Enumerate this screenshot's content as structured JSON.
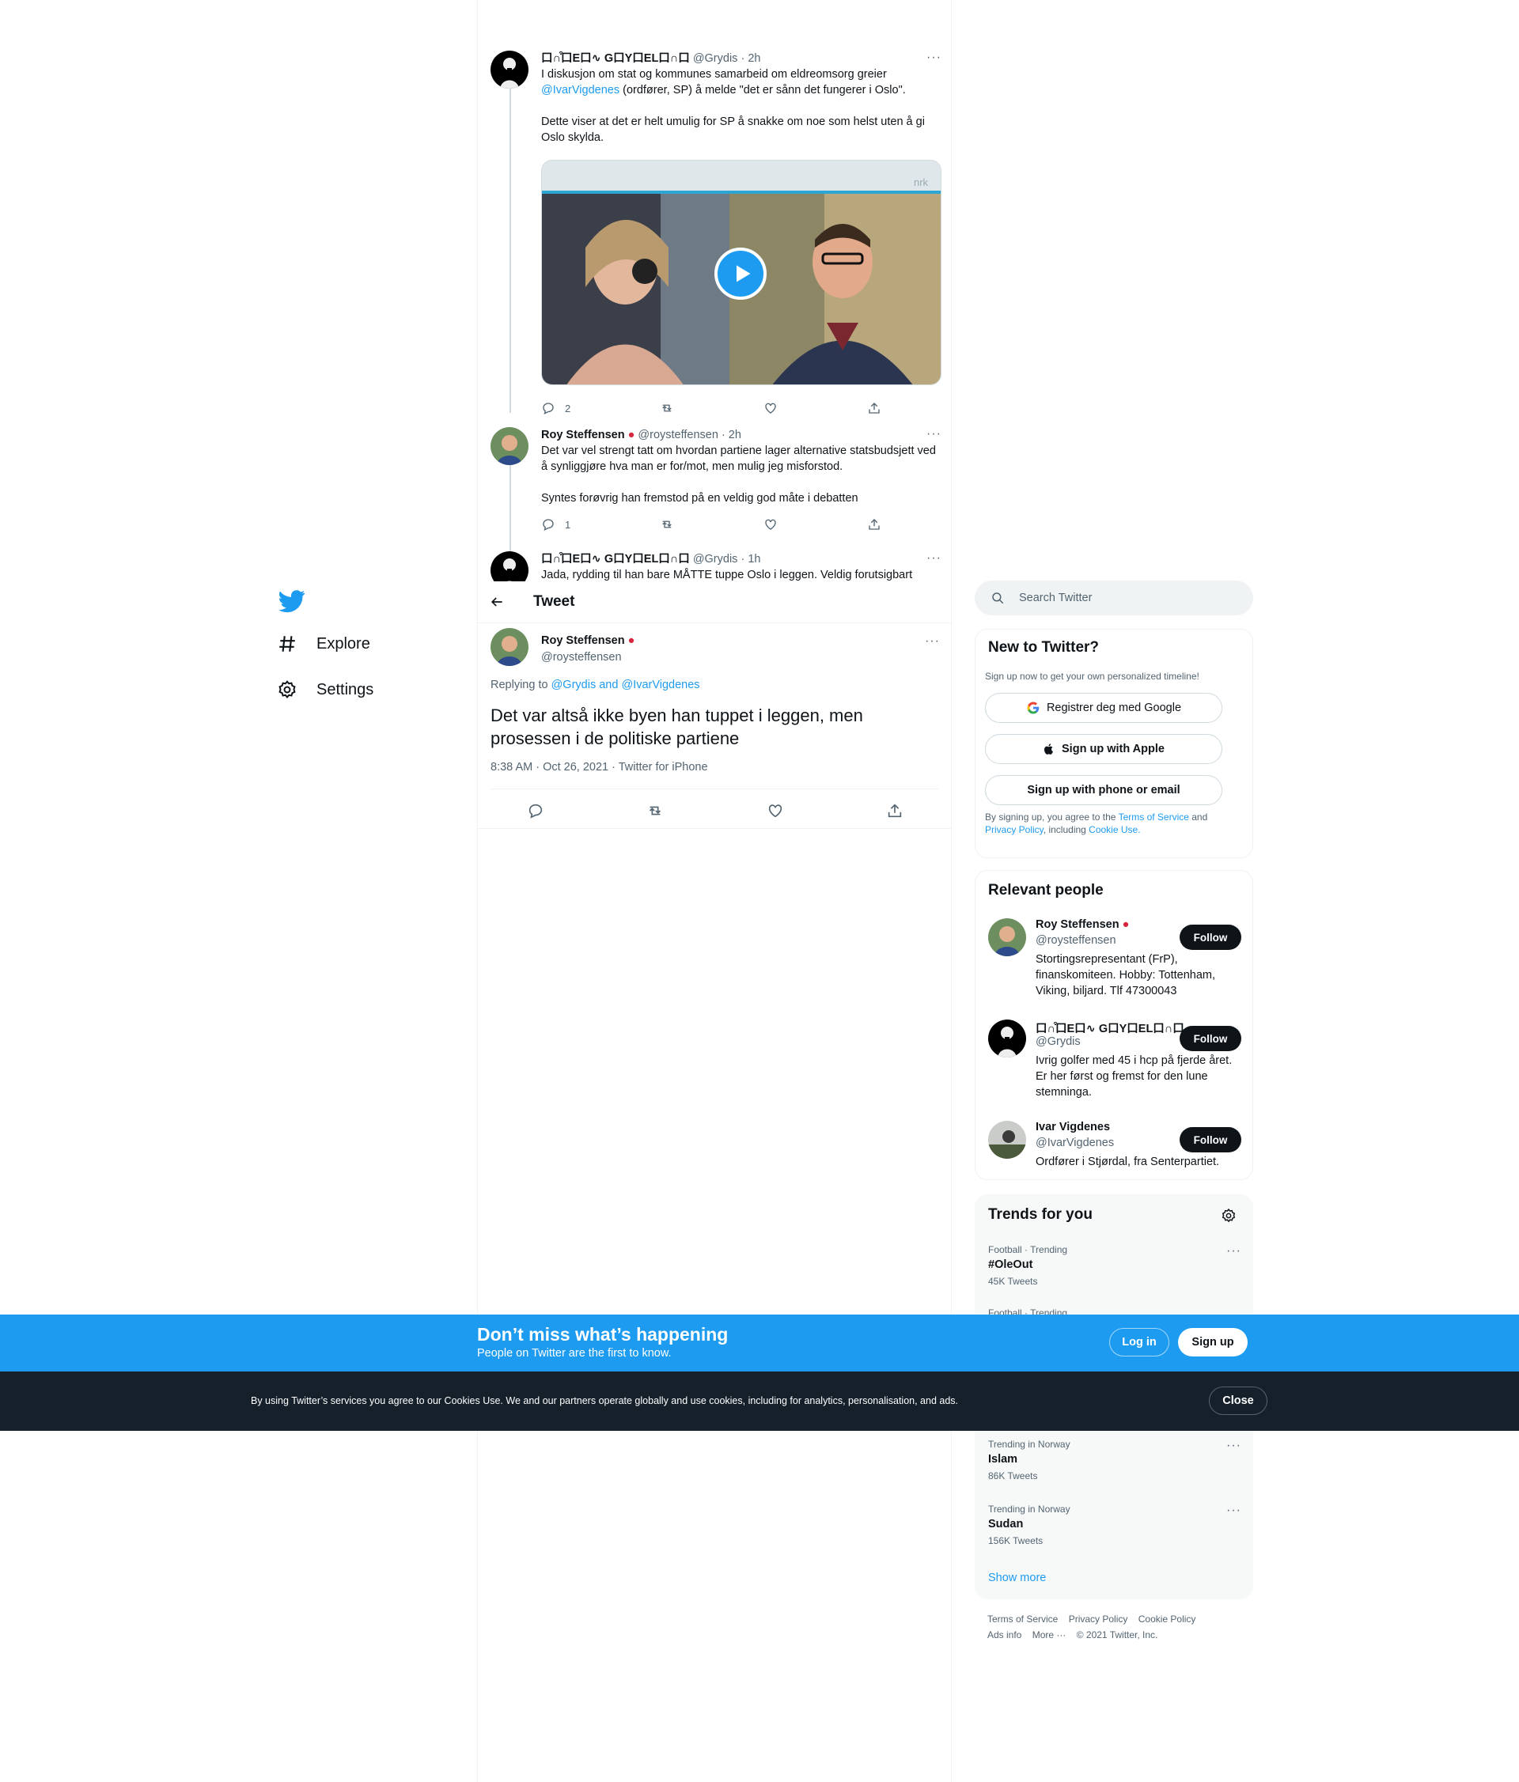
{
  "nav": {
    "items": [
      {
        "label": "Explore",
        "icon": "hashtag-icon"
      },
      {
        "label": "Settings",
        "icon": "gear-icon"
      }
    ]
  },
  "thread": [
    {
      "name": "⼝∩͒⼝E⼝∿ G⼝Y⼝EL⼝∩⼝",
      "handle": "@Grydis",
      "time": "· 2h",
      "text_pre": "I diskusjon om stat og kommunes samarbeid om eldreomsorg greier",
      "mention": "@IvarVigdenes",
      "text_post": " (ordfører, SP) å melde \"det er sånn det fungerer i Oslo\".\n\nDette viser at det er helt umulig for SP å snakke om noe som helst uten å gi Oslo skylda.",
      "replies": "2",
      "media_badge": "nrk"
    },
    {
      "name": "Roy Steffensen",
      "handle": "@roysteffensen",
      "time": "· 2h",
      "text": "Det var vel strengt tatt om hvordan partiene lager alternative statsbudsjett ved å synliggjøre hva man er for/mot, men mulig jeg misforstod.\n\nSyntes forøvrig han fremstod på en veldig god måte i debatten",
      "replies": "1"
    },
    {
      "name": "⼝∩͒⼝E⼝∿ G⼝Y⼝EL⼝∩⼝",
      "handle": "@Grydis",
      "time": "· 1h",
      "text": "Jada, rydding til han bare MÅTTE tuppe Oslo i leggen. Veldig forutsigbart"
    }
  ],
  "header": {
    "title": "Tweet"
  },
  "main_tweet": {
    "name": "Roy Steffensen",
    "handle": "@roysteffensen",
    "replying_prefix": "Replying to ",
    "replying_to": "@Grydis and @IvarVigdenes",
    "text": "Det var altså ikke byen han tuppet i leggen, men prosessen i de politiske partiene",
    "meta": "8:38 AM · Oct 26, 2021 · Twitter for iPhone"
  },
  "search": {
    "placeholder": "Search Twitter"
  },
  "signup": {
    "title": "New to Twitter?",
    "subtitle": "Sign up now to get your own personalized timeline!",
    "google": "Registrer deg med Google",
    "apple": "Sign up with Apple",
    "phone": "Sign up with phone or email",
    "legal_1": "By signing up, you agree to the ",
    "terms": "Terms of Service",
    "legal_2": " and ",
    "privacy": "Privacy Policy",
    "legal_3": ", including ",
    "cookie": "Cookie Use."
  },
  "relevant": {
    "title": "Relevant people",
    "follow": "Follow",
    "people": [
      {
        "name": "Roy Steffensen",
        "handle": "@roysteffensen",
        "bio": "Stortingsrepresentant (FrP), finanskomiteen. Hobby: Tottenham, Viking, biljard. Tlf 47300043"
      },
      {
        "name": "⼝∩͒⼝E⼝∿ G⼝Y⼝EL⼝∩⼝",
        "handle": "@Grydis",
        "bio": "Ivrig golfer med 45 i hcp på fjerde året. Er her først og fremst for den lune stemninga."
      },
      {
        "name": "Ivar Vigdenes",
        "handle": "@IvarVigdenes",
        "bio": "Ordfører i Stjørdal, fra Senterpartiet."
      }
    ]
  },
  "trends": {
    "title": "Trends for you",
    "items": [
      {
        "context": "Football · Trending",
        "name": "#OleOut",
        "count": "45K Tweets"
      },
      {
        "context": "Football · Trending",
        "name": "",
        "count": ""
      },
      {
        "context": "Trending in Norway",
        "name": "Islam",
        "count": "86K Tweets"
      },
      {
        "context": "Trending in Norway",
        "name": "Sudan",
        "count": "156K Tweets"
      }
    ],
    "show_more": "Show more"
  },
  "footer": {
    "links": [
      "Terms of Service",
      "Privacy Policy",
      "Cookie Policy",
      "Ads info",
      "More ···",
      "© 2021 Twitter, Inc."
    ]
  },
  "bottom_bar": {
    "title": "Don’t miss what’s happening",
    "subtitle": "People on Twitter are the first to know.",
    "login": "Log in",
    "signup": "Sign up"
  },
  "cookie_bar": {
    "text": "By using Twitter’s services you agree to our Cookies Use. We and our partners operate globally and use cookies, including for analytics, personalisation, and ads.",
    "close": "Close"
  },
  "colors": {
    "accent": "#1d9bf0",
    "dark": "#0f1419",
    "cookie_bg": "#15202b",
    "muted": "#536471"
  }
}
